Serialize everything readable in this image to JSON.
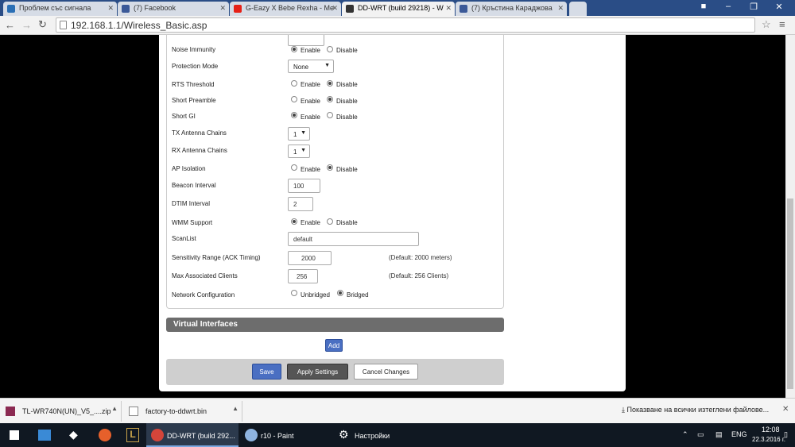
{
  "browser": {
    "tabs": [
      {
        "title": "Проблем със сигнала",
        "icon_color": "#2a6fb5",
        "active": false
      },
      {
        "title": "(7) Facebook",
        "icon_color": "#3b5998",
        "active": false
      },
      {
        "title": "G-Eazy X Bebe Rexha - Me",
        "icon_color": "#e62117",
        "active": false
      },
      {
        "title": "DD-WRT (build 29218) - W",
        "icon_color": "#333333",
        "active": true
      },
      {
        "title": "(7) Кръстина Караджова",
        "icon_color": "#3b5998",
        "active": false
      }
    ],
    "url": "192.168.1.1/Wireless_Basic.asp"
  },
  "settings": {
    "noise_immunity": {
      "label": "Noise Immunity",
      "opt1": "Enable",
      "opt2": "Disable"
    },
    "protection_mode": {
      "label": "Protection Mode",
      "value": "None"
    },
    "rts_threshold": {
      "label": "RTS Threshold",
      "opt1": "Enable",
      "opt2": "Disable"
    },
    "short_preamble": {
      "label": "Short Preamble",
      "opt1": "Enable",
      "opt2": "Disable"
    },
    "short_gi": {
      "label": "Short GI",
      "opt1": "Enable",
      "opt2": "Disable"
    },
    "tx_antenna": {
      "label": "TX Antenna Chains",
      "value": "1"
    },
    "rx_antenna": {
      "label": "RX Antenna Chains",
      "value": "1"
    },
    "ap_isolation": {
      "label": "AP Isolation",
      "opt1": "Enable",
      "opt2": "Disable"
    },
    "beacon_interval": {
      "label": "Beacon Interval",
      "value": "100"
    },
    "dtim_interval": {
      "label": "DTIM Interval",
      "value": "2"
    },
    "wmm_support": {
      "label": "WMM Support",
      "opt1": "Enable",
      "opt2": "Disable"
    },
    "scanlist": {
      "label": "ScanList",
      "value": "default"
    },
    "sensitivity": {
      "label": "Sensitivity Range (ACK Timing)",
      "value": "2000",
      "note": "(Default: 2000 meters)"
    },
    "max_clients": {
      "label": "Max Associated Clients",
      "value": "256",
      "note": "(Default: 256 Clients)"
    },
    "network_config": {
      "label": "Network Configuration",
      "opt1": "Unbridged",
      "opt2": "Bridged"
    }
  },
  "virtual_interfaces": {
    "title": "Virtual Interfaces",
    "add": "Add"
  },
  "buttons": {
    "save": "Save",
    "apply": "Apply Settings",
    "cancel": "Cancel Changes"
  },
  "downloads": {
    "items": [
      "TL-WR740N(UN)_V5_....zip",
      "factory-to-ddwrt.bin"
    ],
    "show_all": "Показване на всички изтеглени файлове..."
  },
  "taskbar": {
    "apps": [
      "DD-WRT (build 292...",
      "r10 - Paint",
      "Настройки"
    ],
    "lang": "ENG",
    "time": "12:08",
    "date": "22.3.2016 г."
  }
}
